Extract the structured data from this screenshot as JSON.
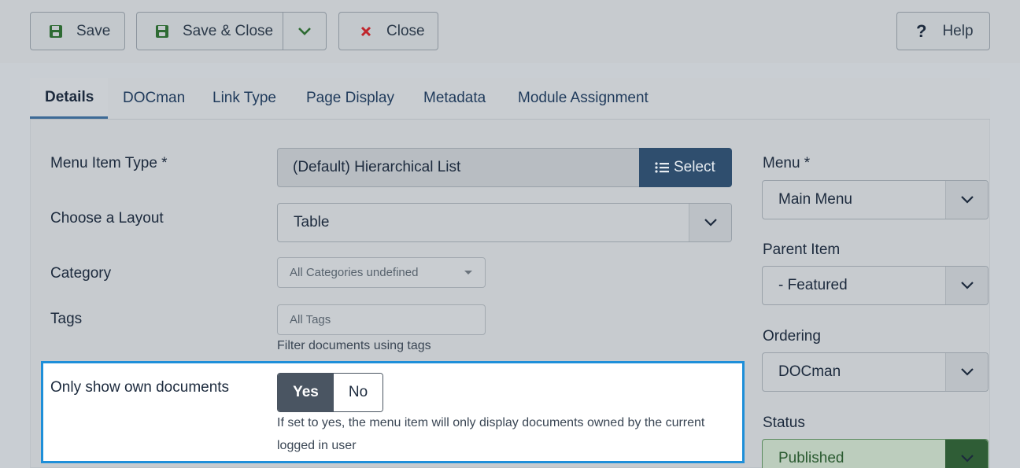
{
  "toolbar": {
    "save_label": "Save",
    "save_close_label": "Save & Close",
    "close_label": "Close",
    "help_label": "Help",
    "help_glyph": "?"
  },
  "tabs": [
    {
      "label": "Details",
      "active": true
    },
    {
      "label": "DOCman"
    },
    {
      "label": "Link Type"
    },
    {
      "label": "Page Display"
    },
    {
      "label": "Metadata"
    },
    {
      "label": "Module Assignment"
    }
  ],
  "form": {
    "menu_item_type": {
      "label": "Menu Item Type *",
      "value": "(Default) Hierarchical List",
      "button_label": "Select"
    },
    "layout": {
      "label": "Choose a Layout",
      "value": "Table"
    },
    "category": {
      "label": "Category",
      "placeholder": "All Categories undefined"
    },
    "tags": {
      "label": "Tags",
      "placeholder": "All Tags",
      "hint": "Filter documents using tags"
    },
    "own_documents": {
      "label": "Only show own documents",
      "yes_label": "Yes",
      "no_label": "No",
      "selected": "Yes",
      "hint_line1": "If set to yes, the menu item will only display documents owned by the current",
      "hint_line2": "logged in user"
    }
  },
  "sidebar": {
    "menu": {
      "label": "Menu *",
      "value": "Main Menu"
    },
    "parent": {
      "label": "Parent Item",
      "value": "- Featured"
    },
    "ordering": {
      "label": "Ordering",
      "value": "DOCman"
    },
    "status": {
      "label": "Status",
      "value": "Published"
    }
  },
  "colors": {
    "highlight_border": "#1e8fd9",
    "select_button": "#2f4e6e",
    "save_icon": "#2e6b33",
    "close_icon": "#c0262d"
  },
  "icons": [
    "save-icon",
    "chevron-down-icon",
    "close-icon",
    "help-icon",
    "list-icon"
  ]
}
